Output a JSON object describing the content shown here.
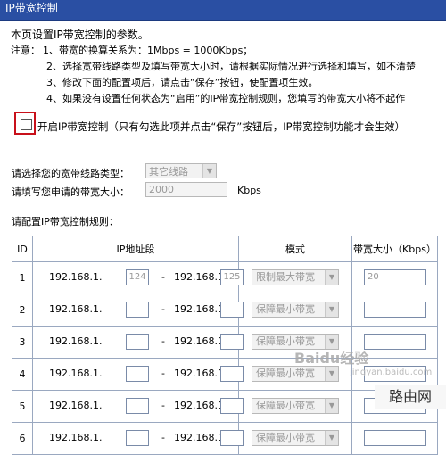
{
  "window": {
    "title": "IP带宽控制"
  },
  "intro": "本页设置IP带宽控制的参数。",
  "notes": {
    "label": "注意：",
    "lines": [
      "1、带宽的换算关系为：1Mbps = 1000Kbps；",
      "2、选择宽带线路类型及填写带宽大小时，请根据实际情况进行选择和填写，如不清楚",
      "3、修改下面的配置项后，请点击“保存”按钮，使配置项生效。",
      "4、如果没有设置任何状态为“启用”的IP带宽控制规则，您填写的带宽大小将不起作"
    ]
  },
  "enable": {
    "label": "开启IP带宽控制（只有勾选此项并点击“保存”按钮后，IP带宽控制功能才会生效）",
    "checked": false
  },
  "line_type": {
    "label": "请选择您的宽带线路类型：",
    "value": "其它线路"
  },
  "bandwidth": {
    "label": "请填写您申请的带宽大小：",
    "value": "2000",
    "unit": "Kbps"
  },
  "rules_title": "请配置IP带宽控制规则：",
  "table": {
    "headers": [
      "ID",
      "IP地址段",
      "模式",
      "带宽大小（Kbps）"
    ],
    "rows": [
      {
        "id": "1",
        "prefix1": "192.168.1.",
        "start": "124",
        "prefix2": "192.168.1.",
        "end": "125",
        "mode": "限制最大带宽",
        "bw": "20"
      },
      {
        "id": "2",
        "prefix1": "192.168.1.",
        "start": "",
        "prefix2": "192.168.1.",
        "end": "",
        "mode": "保障最小带宽",
        "bw": ""
      },
      {
        "id": "3",
        "prefix1": "192.168.1.",
        "start": "",
        "prefix2": "192.168.1.",
        "end": "",
        "mode": "保障最小带宽",
        "bw": ""
      },
      {
        "id": "4",
        "prefix1": "192.168.1.",
        "start": "",
        "prefix2": "192.168.1.",
        "end": "",
        "mode": "保障最小带宽",
        "bw": ""
      },
      {
        "id": "5",
        "prefix1": "192.168.1.",
        "start": "",
        "prefix2": "192.168.1.",
        "end": "",
        "mode": "保障最小带宽",
        "bw": ""
      },
      {
        "id": "6",
        "prefix1": "192.168.1.",
        "start": "",
        "prefix2": "192.168.1.",
        "end": "",
        "mode": "保障最小带宽",
        "bw": ""
      }
    ]
  },
  "watermark": {
    "text": "Baidu经验",
    "sub": "jingyan.baidu.com",
    "badge": "路由网"
  }
}
